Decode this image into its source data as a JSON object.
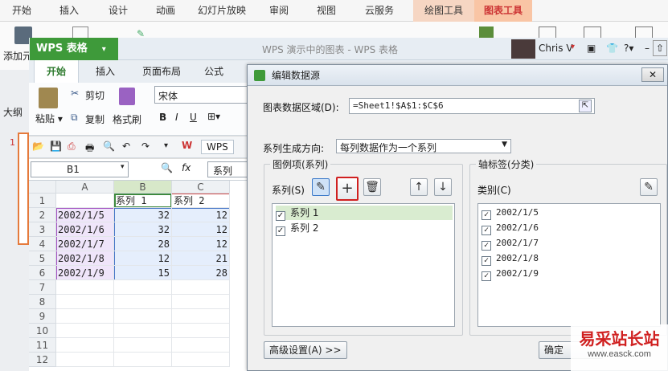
{
  "ppt": {
    "tabs": [
      "开始",
      "插入",
      "设计",
      "动画",
      "幻灯片放映",
      "审阅",
      "视图",
      "云服务",
      "绘图工具",
      "图表工具"
    ],
    "add_label": "添加元",
    "outline_label": "大纲",
    "slide_number": "1"
  },
  "excel": {
    "logo": "WPS 表格",
    "window_title": "WPS 演示中的图表 - WPS 表格",
    "user": "Chris V",
    "tabs": [
      "开始",
      "插入",
      "页面布局",
      "公式"
    ],
    "paste_label": "粘贴",
    "cut_label": "剪切",
    "copy_label": "复制",
    "format_painter_label": "格式刷",
    "font_name": "宋体",
    "bold": "B",
    "italic": "I",
    "underline": "U",
    "wps_tab": "WPS",
    "cell_ref": "B1",
    "fx": "fx",
    "formula_value": "系列",
    "columns": [
      "A",
      "B",
      "C"
    ],
    "rows": [
      "1",
      "2",
      "3",
      "4",
      "5",
      "6",
      "7",
      "8",
      "9",
      "10",
      "11",
      "12"
    ],
    "header_row": [
      "",
      "系列 1",
      "系列 2"
    ],
    "data": [
      [
        "2002/1/5",
        "32",
        "12"
      ],
      [
        "2002/1/6",
        "32",
        "12"
      ],
      [
        "2002/1/7",
        "28",
        "12"
      ],
      [
        "2002/1/8",
        "12",
        "21"
      ],
      [
        "2002/1/9",
        "15",
        "28"
      ]
    ]
  },
  "dialog": {
    "title": "编辑数据源",
    "range_label": "图表数据区域(D):",
    "range_value": "=Sheet1!$A$1:$C$6",
    "direction_label": "系列生成方向:",
    "direction_value": "每列数据作为一个系列",
    "legend_group": "图例项(系列)",
    "series_label": "系列(S)",
    "series": [
      "系列 1",
      "系列 2"
    ],
    "axis_group": "轴标签(分类)",
    "category_label": "类别(C)",
    "categories": [
      "2002/1/5",
      "2002/1/6",
      "2002/1/7",
      "2002/1/8",
      "2002/1/9"
    ],
    "advanced_label": "高级设置(A) >>",
    "ok_label": "确定"
  },
  "watermark": {
    "title": "易采站长站",
    "url": "www.easck.com"
  },
  "colors": {
    "wps_green": "#3e9a3a",
    "chart_tool_tab": "#f9c5a5",
    "add_button_border": "#d02020"
  }
}
